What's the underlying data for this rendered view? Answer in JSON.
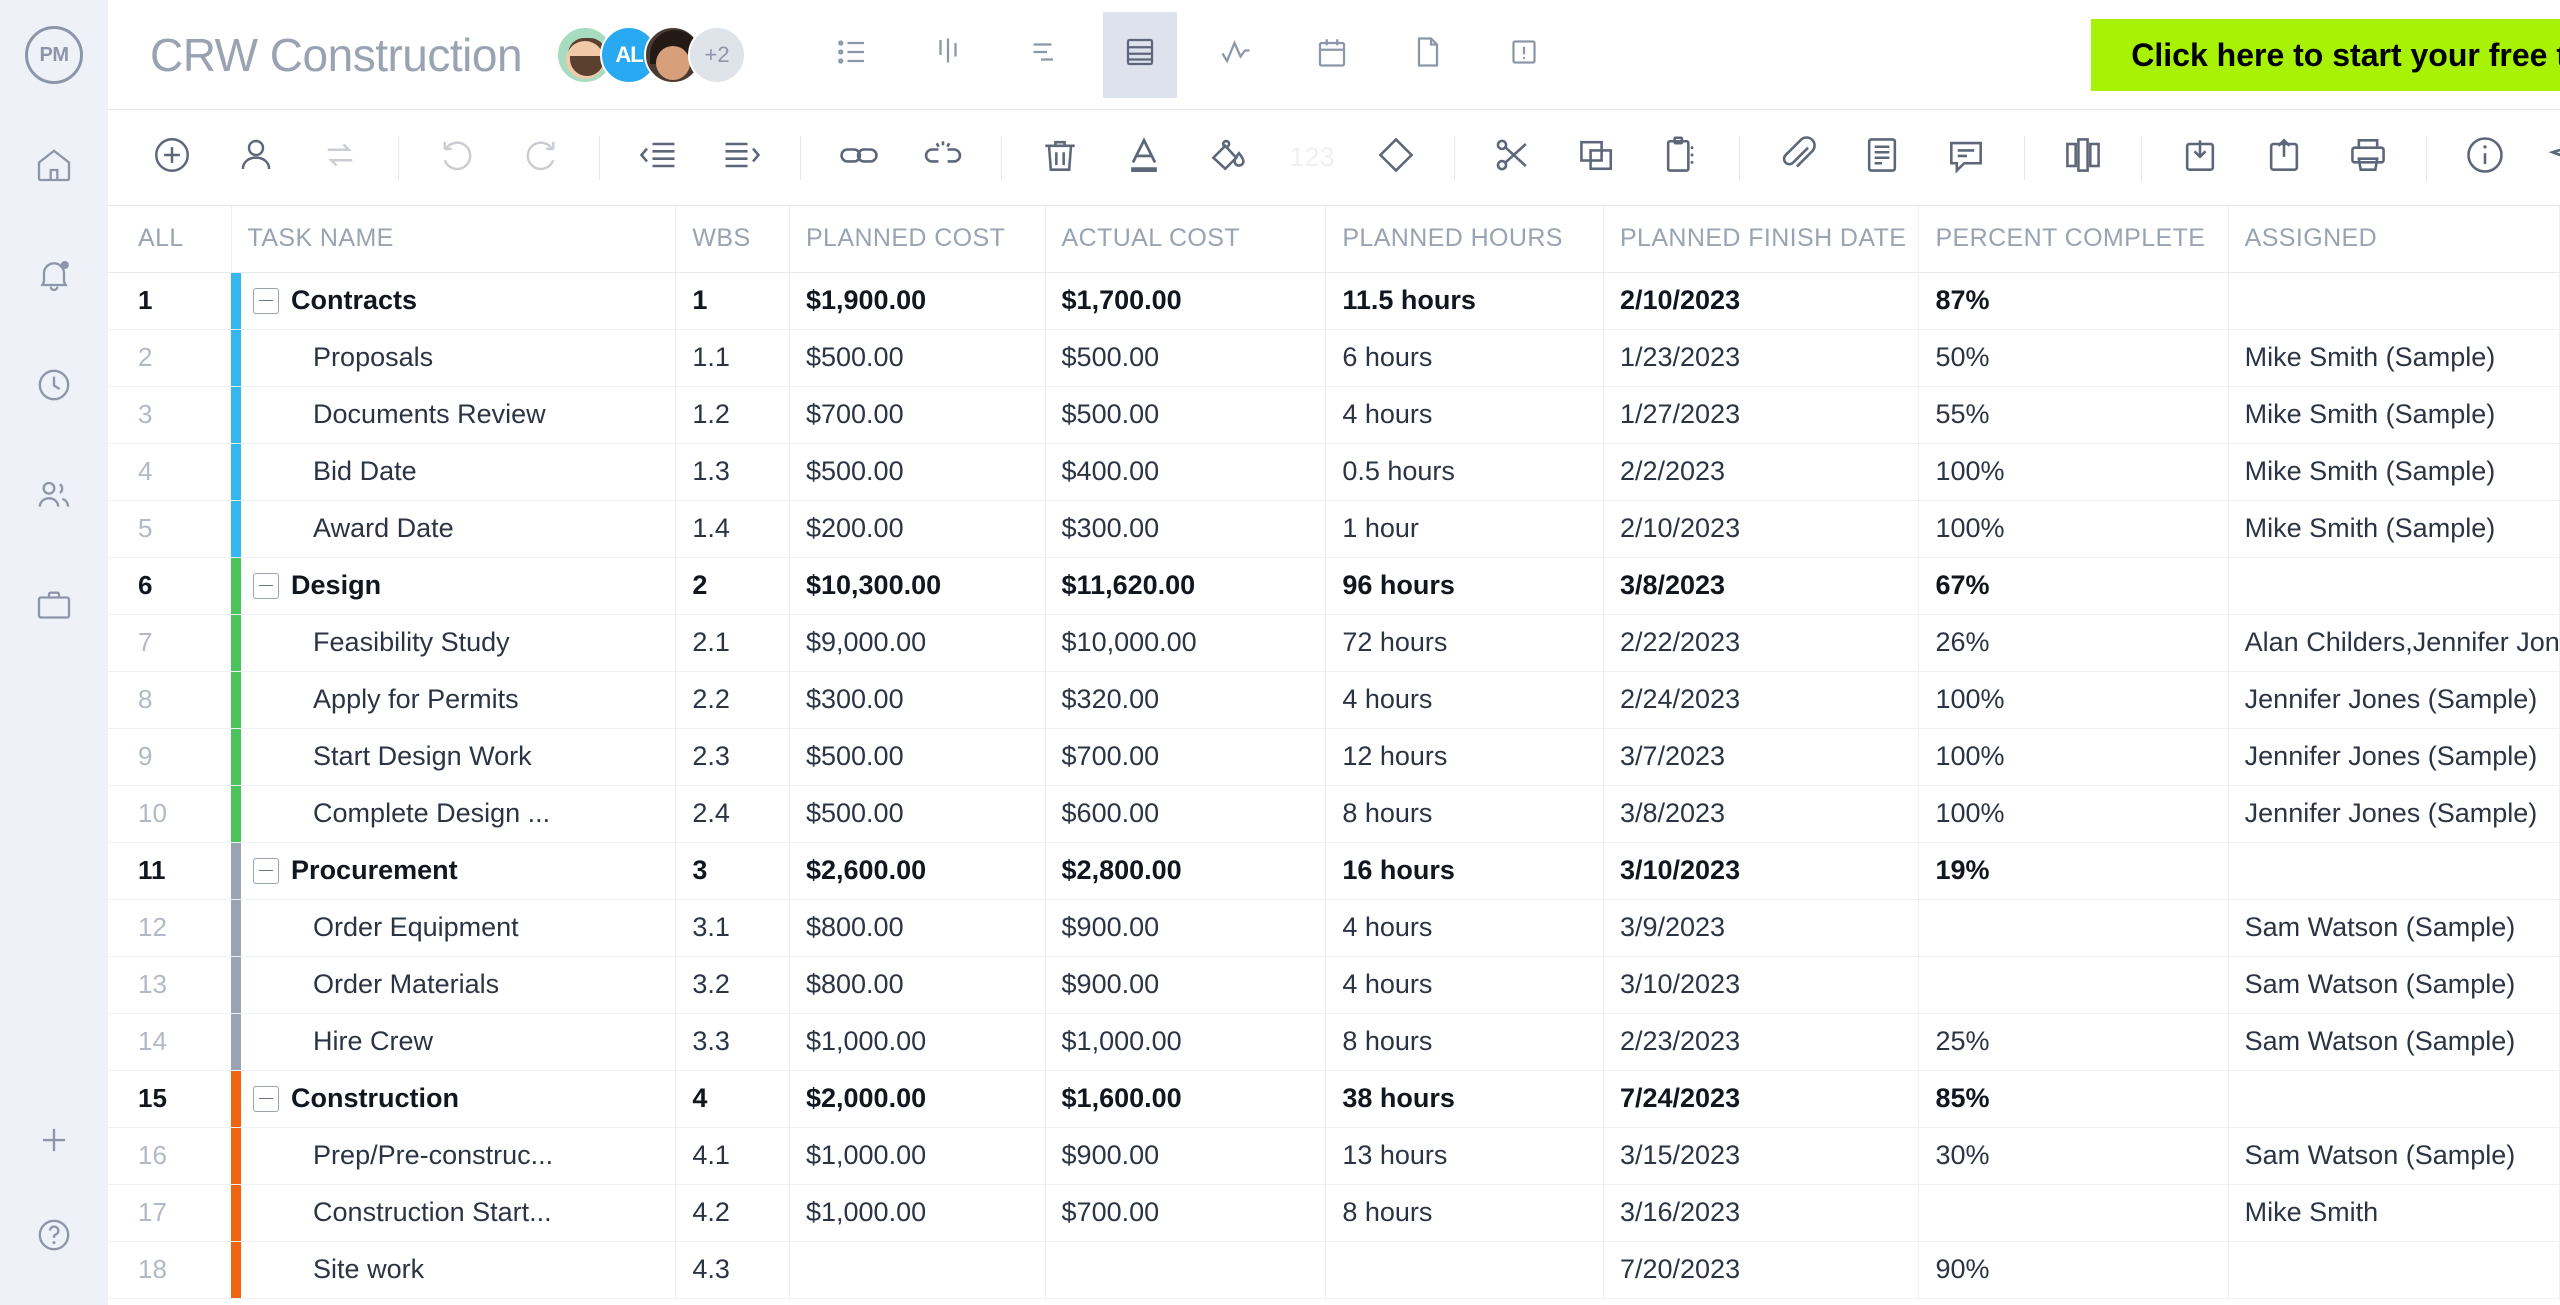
{
  "brand": {
    "logo_text": "PM"
  },
  "sidebar": {
    "items": [
      {
        "name": "home",
        "icon": "home-icon",
        "label": "Home"
      },
      {
        "name": "notifications",
        "icon": "bell-icon",
        "label": "Notifications"
      },
      {
        "name": "timesheets",
        "icon": "clock-icon",
        "label": "Timesheets"
      },
      {
        "name": "team",
        "icon": "people-icon",
        "label": "Team"
      },
      {
        "name": "portfolio",
        "icon": "briefcase-icon",
        "label": "Portfolio"
      }
    ],
    "bottom": [
      {
        "name": "add",
        "icon": "plus-icon",
        "label": "Add"
      },
      {
        "name": "help",
        "icon": "help-icon",
        "label": "Help"
      }
    ]
  },
  "header": {
    "project_title": "CRW Construction",
    "avatars": [
      {
        "type": "photo",
        "label": ""
      },
      {
        "type": "initials",
        "label": "AL"
      },
      {
        "type": "photo",
        "label": ""
      },
      {
        "type": "overflow",
        "label": "+2"
      }
    ],
    "view_tabs": [
      {
        "name": "list-view",
        "icon": "list-icon",
        "active": false
      },
      {
        "name": "board-view",
        "icon": "board-icon",
        "active": false
      },
      {
        "name": "gantt-view",
        "icon": "gantt-icon",
        "active": false
      },
      {
        "name": "sheet-view",
        "icon": "sheet-icon",
        "active": true
      },
      {
        "name": "workload-view",
        "icon": "activity-icon",
        "active": false
      },
      {
        "name": "calendar-view",
        "icon": "calendar-icon",
        "active": false
      },
      {
        "name": "pages-view",
        "icon": "page-icon",
        "active": false
      },
      {
        "name": "issues-view",
        "icon": "alert-icon",
        "active": false
      }
    ],
    "trial_cta": "Click here to start your free trial",
    "trial_bg": "#a7f205",
    "search_icon": "search-icon"
  },
  "toolbar": {
    "groups": [
      [
        {
          "name": "add-task-button",
          "icon": "circle-plus-icon",
          "dim": false
        },
        {
          "name": "assign-resource-button",
          "icon": "person-icon",
          "dim": false
        },
        {
          "name": "recurring-task-button",
          "icon": "sync-icon",
          "dim": true
        }
      ],
      [
        {
          "name": "undo-button",
          "icon": "undo-icon",
          "dim": true
        },
        {
          "name": "redo-button",
          "icon": "redo-icon",
          "dim": true
        }
      ],
      [
        {
          "name": "outdent-button",
          "icon": "outdent-icon",
          "dim": false
        },
        {
          "name": "indent-button",
          "icon": "indent-icon",
          "dim": false
        }
      ],
      [
        {
          "name": "link-tasks-button",
          "icon": "link-icon",
          "dim": false
        },
        {
          "name": "unlink-tasks-button",
          "icon": "unlink-icon",
          "dim": false
        }
      ],
      [
        {
          "name": "delete-button",
          "icon": "trash-icon",
          "dim": false
        },
        {
          "name": "text-color-button",
          "icon": "text-color-icon",
          "dim": false
        },
        {
          "name": "fill-color-button",
          "icon": "paint-bucket-icon",
          "dim": false
        },
        {
          "name": "number-format-button",
          "icon": "123-icon",
          "dim": true,
          "text": "123"
        },
        {
          "name": "milestone-button",
          "icon": "diamond-icon",
          "dim": false
        }
      ],
      [
        {
          "name": "cut-button",
          "icon": "scissors-icon",
          "dim": false
        },
        {
          "name": "copy-button",
          "icon": "copy-icon",
          "dim": false
        },
        {
          "name": "paste-button",
          "icon": "clipboard-icon",
          "dim": false
        }
      ],
      [
        {
          "name": "attachment-button",
          "icon": "paperclip-icon",
          "dim": false
        },
        {
          "name": "notes-button",
          "icon": "notes-icon",
          "dim": false
        },
        {
          "name": "comment-button",
          "icon": "comment-icon",
          "dim": false
        }
      ],
      [
        {
          "name": "columns-button",
          "icon": "columns-icon",
          "dim": false
        }
      ],
      [
        {
          "name": "import-button",
          "icon": "import-icon",
          "dim": false
        },
        {
          "name": "export-button",
          "icon": "export-icon",
          "dim": false
        },
        {
          "name": "print-button",
          "icon": "print-icon",
          "dim": false
        }
      ],
      [
        {
          "name": "info-button",
          "icon": "info-icon",
          "dim": false
        },
        {
          "name": "send-button",
          "icon": "send-icon",
          "dim": false
        },
        {
          "name": "lock-button",
          "icon": "lock-icon",
          "dim": false
        },
        {
          "name": "more-button",
          "icon": "ellipsis-icon",
          "dim": false
        }
      ]
    ]
  },
  "table": {
    "columns": [
      "ALL",
      "TASK NAME",
      "WBS",
      "PLANNED COST",
      "ACTUAL COST",
      "PLANNED HOURS",
      "PLANNED FINISH DATE",
      "PERCENT COMPLETE",
      "ASSIGNED"
    ],
    "group_colors": {
      "contracts": "#36b6ef",
      "design": "#4bc45b",
      "procurement": "#9aa3b2",
      "construction": "#ef6410"
    },
    "rows": [
      {
        "num": "1",
        "type": "group",
        "color": "#36b6ef",
        "name": "Contracts",
        "wbs": "1",
        "planned_cost": "$1,900.00",
        "actual_cost": "$1,700.00",
        "planned_hours": "11.5 hours",
        "planned_finish": "2/10/2023",
        "percent": "87%",
        "assigned": ""
      },
      {
        "num": "2",
        "type": "child",
        "color": "#36b6ef",
        "name": "Proposals",
        "wbs": "1.1",
        "planned_cost": "$500.00",
        "actual_cost": "$500.00",
        "planned_hours": "6 hours",
        "planned_finish": "1/23/2023",
        "percent": "50%",
        "assigned": "Mike Smith (Sample)"
      },
      {
        "num": "3",
        "type": "child",
        "color": "#36b6ef",
        "name": "Documents Review",
        "wbs": "1.2",
        "planned_cost": "$700.00",
        "actual_cost": "$500.00",
        "planned_hours": "4 hours",
        "planned_finish": "1/27/2023",
        "percent": "55%",
        "assigned": "Mike Smith (Sample)"
      },
      {
        "num": "4",
        "type": "child",
        "color": "#36b6ef",
        "name": "Bid Date",
        "wbs": "1.3",
        "planned_cost": "$500.00",
        "actual_cost": "$400.00",
        "planned_hours": "0.5 hours",
        "planned_finish": "2/2/2023",
        "percent": "100%",
        "assigned": "Mike Smith (Sample)"
      },
      {
        "num": "5",
        "type": "child",
        "color": "#36b6ef",
        "name": "Award Date",
        "wbs": "1.4",
        "planned_cost": "$200.00",
        "actual_cost": "$300.00",
        "planned_hours": "1 hour",
        "planned_finish": "2/10/2023",
        "percent": "100%",
        "assigned": "Mike Smith (Sample)"
      },
      {
        "num": "6",
        "type": "group",
        "color": "#4bc45b",
        "name": "Design",
        "wbs": "2",
        "planned_cost": "$10,300.00",
        "actual_cost": "$11,620.00",
        "planned_hours": "96 hours",
        "planned_finish": "3/8/2023",
        "percent": "67%",
        "assigned": ""
      },
      {
        "num": "7",
        "type": "child",
        "color": "#4bc45b",
        "name": "Feasibility Study",
        "wbs": "2.1",
        "planned_cost": "$9,000.00",
        "actual_cost": "$10,000.00",
        "planned_hours": "72 hours",
        "planned_finish": "2/22/2023",
        "percent": "26%",
        "assigned": "Alan Childers,Jennifer Jones (Sample)"
      },
      {
        "num": "8",
        "type": "child",
        "color": "#4bc45b",
        "name": "Apply for Permits",
        "wbs": "2.2",
        "planned_cost": "$300.00",
        "actual_cost": "$320.00",
        "planned_hours": "4 hours",
        "planned_finish": "2/24/2023",
        "percent": "100%",
        "assigned": "Jennifer Jones (Sample)"
      },
      {
        "num": "9",
        "type": "child",
        "color": "#4bc45b",
        "name": "Start Design Work",
        "wbs": "2.3",
        "planned_cost": "$500.00",
        "actual_cost": "$700.00",
        "planned_hours": "12 hours",
        "planned_finish": "3/7/2023",
        "percent": "100%",
        "assigned": "Jennifer Jones (Sample)"
      },
      {
        "num": "10",
        "type": "child",
        "color": "#4bc45b",
        "name": "Complete Design ...",
        "wbs": "2.4",
        "planned_cost": "$500.00",
        "actual_cost": "$600.00",
        "planned_hours": "8 hours",
        "planned_finish": "3/8/2023",
        "percent": "100%",
        "assigned": "Jennifer Jones (Sample)"
      },
      {
        "num": "11",
        "type": "group",
        "color": "#9aa3b2",
        "name": "Procurement",
        "wbs": "3",
        "planned_cost": "$2,600.00",
        "actual_cost": "$2,800.00",
        "planned_hours": "16 hours",
        "planned_finish": "3/10/2023",
        "percent": "19%",
        "assigned": ""
      },
      {
        "num": "12",
        "type": "child",
        "color": "#9aa3b2",
        "name": "Order Equipment",
        "wbs": "3.1",
        "planned_cost": "$800.00",
        "actual_cost": "$900.00",
        "planned_hours": "4 hours",
        "planned_finish": "3/9/2023",
        "percent": "",
        "assigned": "Sam Watson (Sample)"
      },
      {
        "num": "13",
        "type": "child",
        "color": "#9aa3b2",
        "name": "Order Materials",
        "wbs": "3.2",
        "planned_cost": "$800.00",
        "actual_cost": "$900.00",
        "planned_hours": "4 hours",
        "planned_finish": "3/10/2023",
        "percent": "",
        "assigned": "Sam Watson (Sample)"
      },
      {
        "num": "14",
        "type": "child",
        "color": "#9aa3b2",
        "name": "Hire Crew",
        "wbs": "3.3",
        "planned_cost": "$1,000.00",
        "actual_cost": "$1,000.00",
        "planned_hours": "8 hours",
        "planned_finish": "2/23/2023",
        "percent": "25%",
        "assigned": "Sam Watson (Sample)"
      },
      {
        "num": "15",
        "type": "group",
        "color": "#ef6410",
        "name": "Construction",
        "wbs": "4",
        "planned_cost": "$2,000.00",
        "actual_cost": "$1,600.00",
        "planned_hours": "38 hours",
        "planned_finish": "7/24/2023",
        "percent": "85%",
        "assigned": ""
      },
      {
        "num": "16",
        "type": "child",
        "color": "#ef6410",
        "name": "Prep/Pre-construc...",
        "wbs": "4.1",
        "planned_cost": "$1,000.00",
        "actual_cost": "$900.00",
        "planned_hours": "13 hours",
        "planned_finish": "3/15/2023",
        "percent": "30%",
        "assigned": "Sam Watson (Sample)"
      },
      {
        "num": "17",
        "type": "child",
        "color": "#ef6410",
        "name": "Construction Start...",
        "wbs": "4.2",
        "planned_cost": "$1,000.00",
        "actual_cost": "$700.00",
        "planned_hours": "8 hours",
        "planned_finish": "3/16/2023",
        "percent": "",
        "assigned": "Mike Smith"
      },
      {
        "num": "18",
        "type": "child",
        "color": "#ef6410",
        "name": "Site work",
        "wbs": "4.3",
        "planned_cost": "",
        "actual_cost": "",
        "planned_hours": "",
        "planned_finish": "7/20/2023",
        "percent": "90%",
        "assigned": ""
      }
    ]
  }
}
